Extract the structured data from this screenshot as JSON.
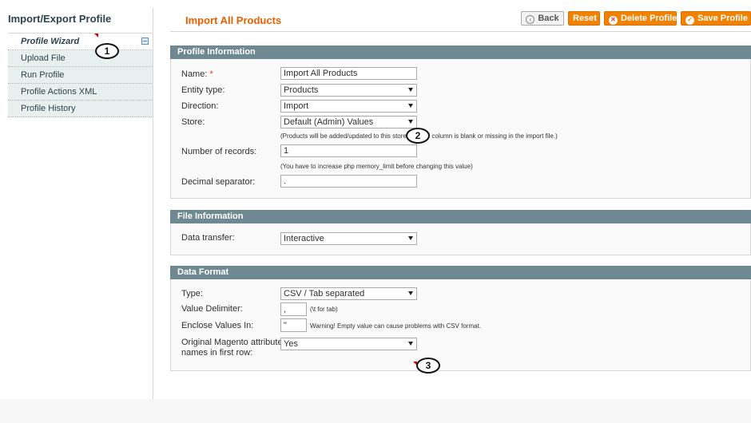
{
  "sidebar": {
    "title": "Import/Export Profile",
    "items": [
      {
        "label": "Profile Wizard"
      },
      {
        "label": "Upload File"
      },
      {
        "label": "Run Profile"
      },
      {
        "label": "Profile Actions XML"
      },
      {
        "label": "Profile History"
      }
    ]
  },
  "header": {
    "title": "Import All Products",
    "buttons": {
      "back": "Back",
      "reset": "Reset",
      "delete": "Delete Profile",
      "save": "Save Profile"
    }
  },
  "profile_information": {
    "heading": "Profile Information",
    "name_label": "Name:",
    "name_required": "*",
    "name_value": "Import All Products",
    "entity_label": "Entity type:",
    "entity_value": "Products",
    "direction_label": "Direction:",
    "direction_value": "Import",
    "store_label": "Store:",
    "store_value": "Default (Admin) Values",
    "store_note": "(Products will be added/updated to this store if 'store' column is blank or missing in the import file.)",
    "records_label": "Number of records:",
    "records_value": "1",
    "records_note": "(You have to increase php memory_limit before changing this value)",
    "decimal_label": "Decimal separator:",
    "decimal_value": "."
  },
  "file_information": {
    "heading": "File Information",
    "transfer_label": "Data transfer:",
    "transfer_value": "Interactive"
  },
  "data_format": {
    "heading": "Data Format",
    "type_label": "Type:",
    "type_value": "CSV / Tab separated",
    "delimiter_label": "Value Delimiter:",
    "delimiter_value": ",",
    "delimiter_note": "(\\t for tab)",
    "enclose_label": "Enclose Values In:",
    "enclose_value": "\"",
    "enclose_note": "Warning! Empty value can cause problems with CSV format.",
    "original_label_line1": "Original Magento attribute",
    "original_label_line2": "names in first row:",
    "original_value": "Yes"
  },
  "callouts": [
    "1",
    "2",
    "3"
  ],
  "colors": {
    "accent_orange": "#f18200",
    "title_orange": "#eb5e00",
    "section_header": "#6f8992",
    "sidebar_bg": "#e7efef"
  },
  "icons": {
    "back": "back-arrow-icon",
    "delete": "delete-icon",
    "save": "save-check-icon",
    "collapse": "collapse-icon",
    "dropdown": "chevron-down-icon"
  }
}
